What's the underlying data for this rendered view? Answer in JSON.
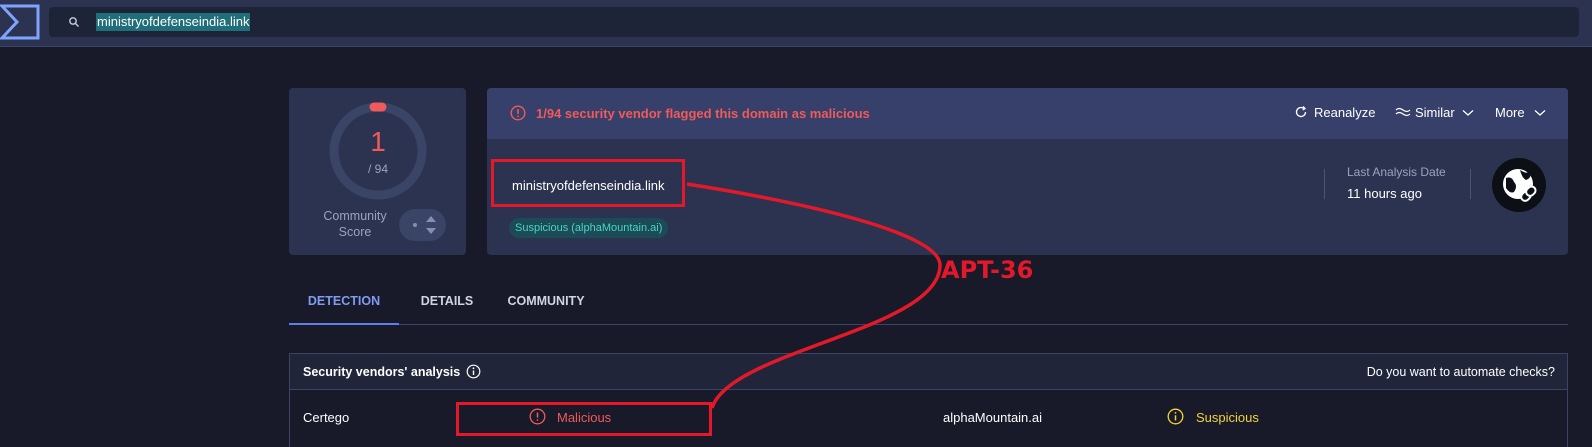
{
  "colors": {
    "background": "#181a29",
    "card": "#2b3350",
    "alert_red": "#f05a5a",
    "annotation_red": "#e3192a",
    "suspicious_yellow": "#f0d43a",
    "tab_active": "#7f9cf0",
    "tag_teal": "#47d6c3"
  },
  "topbar": {
    "logo_icon": "virustotal-sigma-logo",
    "search_icon": "search-icon",
    "search_value": "ministryofdefenseindia.link"
  },
  "score": {
    "detections": "1",
    "total": "/ 94",
    "detection_fraction": 0.0106,
    "community_label_line1": "Community",
    "community_label_line2": "Score"
  },
  "alert": {
    "message": "1/94 security vendor flagged this domain as malicious",
    "reanalyze": "Reanalyze",
    "similar": "Similar",
    "more": "More"
  },
  "domain": {
    "name": "ministryofdefenseindia.link",
    "tag": "Suspicious (alphaMountain.ai)",
    "last_analysis_label": "Last Analysis Date",
    "last_analysis_value": "11 hours ago"
  },
  "annotation": {
    "label": "APT-36"
  },
  "tabs": [
    {
      "label": "DETECTION",
      "active": true
    },
    {
      "label": "DETAILS",
      "active": false
    },
    {
      "label": "COMMUNITY",
      "active": false
    }
  ],
  "vendors": {
    "title": "Security vendors' analysis",
    "automate": "Do you want to automate checks?",
    "rows": [
      {
        "left_vendor": "Certego",
        "left_result": "Malicious",
        "right_vendor": "alphaMountain.ai",
        "right_result": "Suspicious"
      }
    ]
  }
}
